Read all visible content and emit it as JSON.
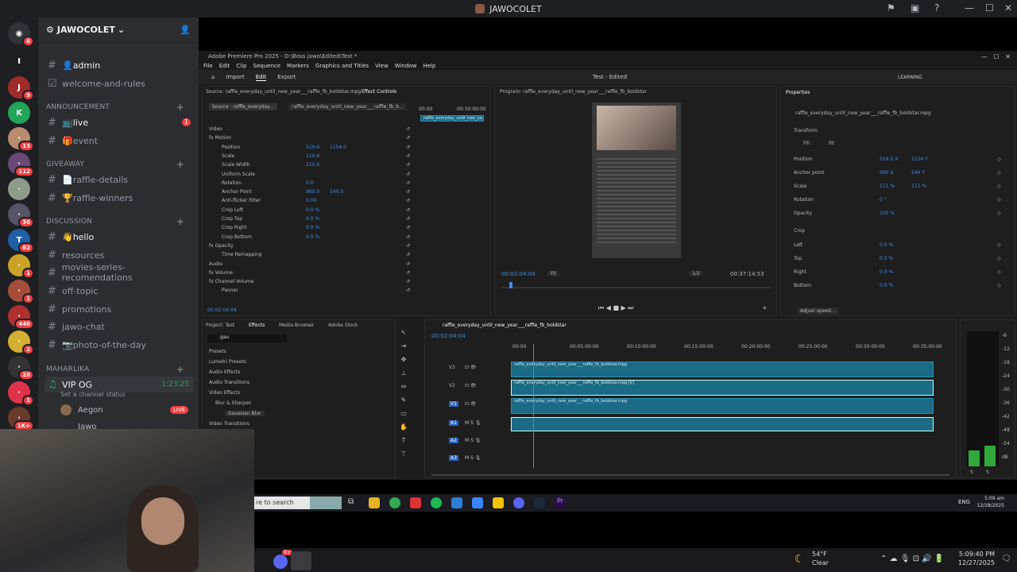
{
  "window_title": "JAWOCOLET",
  "colors": {
    "discord_bg": "#2b2d31",
    "rail_bg": "#1e1f22",
    "live_red": "#f23f43",
    "voice_green": "#23a559",
    "premiere_blue": "#3f8ee9",
    "clip_teal": "#1b6a86"
  },
  "servers": [
    {
      "badge": "6"
    },
    {
      "badge": "9"
    },
    {
      "badge": ""
    },
    {
      "badge": "13"
    },
    {
      "badge": "112"
    },
    {
      "badge": ""
    },
    {
      "badge": "36"
    },
    {
      "badge": "62"
    },
    {
      "badge": "1"
    },
    {
      "badge": "1"
    },
    {
      "badge": "446"
    },
    {
      "badge": "2"
    },
    {
      "badge": "28"
    },
    {
      "badge": "1"
    },
    {
      "badge": "1K+"
    }
  ],
  "guild": {
    "name": "JAWOCOLET"
  },
  "channels": {
    "admin": "👤admin",
    "welcome": "welcome-and-rules",
    "cat_announcement": "ANNOUNCEMENT",
    "live": "📺live",
    "live_badge": "1",
    "event": "🎁event",
    "cat_giveaway": "GIVEAWAY",
    "raffle_details": "📄raffle-details",
    "raffle_winners": "🏆raffle-winners",
    "cat_discussion": "DISCUSSION",
    "hello": "👋hello",
    "resources": "resources",
    "movies": "movies-series-recomendations",
    "offtopic": "off-topic",
    "promotions": "promotions",
    "jawochat": "jawo-chat",
    "photo": "📷photo-of-the-day",
    "cat_maharlika": "MAHARLIKA",
    "vip": "VIP OG",
    "vip_time": "1:23:25",
    "vip_status": "Set a channel status",
    "voice_user1": "Aegon",
    "live_tag": "LIVE",
    "voice_user2": "Jawo"
  },
  "premiere": {
    "title": "Adobe Premiere Pro 2025 - D:\\Boss jawo\\Edited\\Test *",
    "menu": [
      "File",
      "Edit",
      "Clip",
      "Sequence",
      "Markers",
      "Graphics and Titles",
      "View",
      "Window",
      "Help"
    ],
    "tabs": [
      "Import",
      "Edit",
      "Export"
    ],
    "project_name": "Test - Edited",
    "learning": "LEARNING",
    "source_label": "Source: raffle_everyday_until_new_year___raffle_fb_boldstar.mpg",
    "effect_controls": "Effect Controls",
    "source_tab1": "Source · raffle_everyday...",
    "source_tab2": "raffle_everyday_until_new_year___raffle_fb_b...",
    "clip_name": "raffle_everyday_until_new_ye",
    "ec_time1": "00:00",
    "ec_time2": "00:30:00:00",
    "ec_rows": [
      {
        "label": "Video",
        "v1": "",
        "v2": ""
      },
      {
        "label": "fx  Motion",
        "v1": "",
        "v2": ""
      },
      {
        "label": "Position",
        "v1": "519.6",
        "v2": "1154.0"
      },
      {
        "label": "Scale",
        "v1": "110.6",
        "v2": ""
      },
      {
        "label": "Scale Width",
        "v1": "110.6",
        "v2": ""
      },
      {
        "label": "Uniform Scale",
        "v1": "",
        "v2": ""
      },
      {
        "label": "Rotation",
        "v1": "0.0",
        "v2": ""
      },
      {
        "label": "Anchor Point",
        "v1": "960.0",
        "v2": "540.0"
      },
      {
        "label": "Anti-flicker Filter",
        "v1": "0.00",
        "v2": ""
      },
      {
        "label": "Crop Left",
        "v1": "0.0 %",
        "v2": ""
      },
      {
        "label": "Crop Top",
        "v1": "0.0 %",
        "v2": ""
      },
      {
        "label": "Crop Right",
        "v1": "0.0 %",
        "v2": ""
      },
      {
        "label": "Crop Bottom",
        "v1": "0.0 %",
        "v2": ""
      },
      {
        "label": "fx  Opacity",
        "v1": "",
        "v2": ""
      },
      {
        "label": "Time Remapping",
        "v1": "",
        "v2": ""
      },
      {
        "label": "Audio",
        "v1": "",
        "v2": ""
      },
      {
        "label": "fx  Volume",
        "v1": "",
        "v2": ""
      },
      {
        "label": "fx  Channel Volume",
        "v1": "",
        "v2": ""
      },
      {
        "label": "Panner",
        "v1": "",
        "v2": ""
      }
    ],
    "ec_timecode": "00:02:04:04",
    "program_label": "Program: raffle_everyday_until_new_year___raffle_fb_boldstar",
    "program_time": "00:02:04:04",
    "fit": "Fit",
    "resolution": "1/2",
    "duration": "00:37:14:53",
    "properties_title": "Properties",
    "properties_clip": "raffle_everyday_until_new_year___raffle_fb_boldstar.mpg",
    "transform": "Transform",
    "fill": "Fill",
    "fit_btn": "Fit",
    "props": [
      {
        "label": "Position",
        "v1": "519.6 X",
        "v2": "1154 Y"
      },
      {
        "label": "Anchor point",
        "v1": "960 X",
        "v2": "540 Y"
      },
      {
        "label": "Scale",
        "v1": "111 %",
        "v2": "111 %"
      },
      {
        "label": "Rotation",
        "v1": "0 °",
        "v2": ""
      },
      {
        "label": "Opacity",
        "v1": "100 %",
        "v2": ""
      }
    ],
    "crop": "Crop",
    "crops": [
      {
        "label": "Left",
        "v1": "0.0 %"
      },
      {
        "label": "Top",
        "v1": "0.0 %"
      },
      {
        "label": "Right",
        "v1": "0.0 %"
      },
      {
        "label": "Bottom",
        "v1": "0.0 %"
      }
    ],
    "adjust_speed": "Adjust speed...",
    "project_tabs": [
      "Project: Test",
      "Effects",
      "Media Browser",
      "Adobe Stock"
    ],
    "effects_search": "gau",
    "effects_tree": [
      "Presets",
      "Lumetri Presets",
      "Audio Effects",
      "Audio Transitions",
      "Video Effects",
      "Blur & Sharpen",
      "Gaussian Blur",
      "Video Transitions"
    ],
    "seq_name": "raffle_everyday_until_new_year___raffle_fb_boldstar",
    "seq_time": "00:02:04:04",
    "ruler": [
      "00:00",
      "00:05:00:00",
      "00:10:00:00",
      "00:15:00:00",
      "00:20:00:00",
      "00:25:00:00",
      "00:30:00:00",
      "00:35:00:00"
    ],
    "tracks": [
      "V3",
      "V2",
      "V1",
      "A1",
      "A2",
      "A3"
    ],
    "clip_v3": "raffle_everyday_until_new_year___raffle_fb_boldstar.mpg",
    "clip_v2": "raffle_everyday_until_new_year___raffle_fb_boldstar.mpg [V]",
    "clip_v1": "raffle_everyday_until_new_year___raffle_fb_boldstar.mpg",
    "meter_labels": [
      "-6",
      "-12",
      "-18",
      "-24",
      "-30",
      "-36",
      "-42",
      "-48",
      "-54",
      "dB"
    ],
    "meter_sl": [
      "S",
      "S"
    ]
  },
  "taskbar_inner": {
    "search": "re to search",
    "lang": "ENG",
    "time": "5:09 am",
    "date": "12/28/2025"
  },
  "taskbar_outer": {
    "temp": "54°F",
    "weather": "Clear",
    "time": "5:09:40 PM",
    "date": "12/27/2025",
    "badge": "9+"
  }
}
